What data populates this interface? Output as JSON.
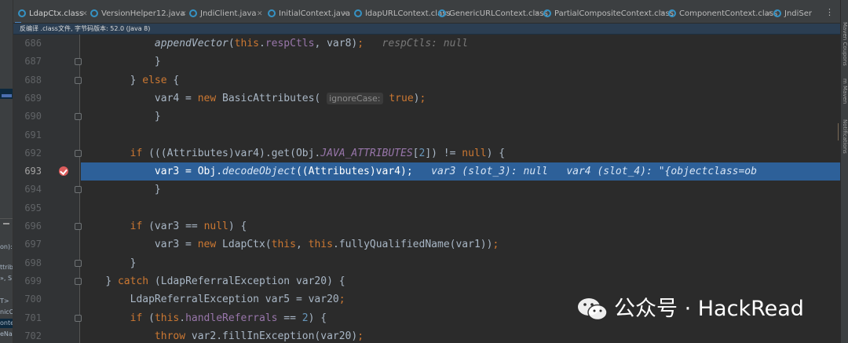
{
  "tabs": [
    {
      "label": "LdapCtx.class",
      "active": true
    },
    {
      "label": "VersionHelper12.java",
      "active": false
    },
    {
      "label": "JndiClient.java",
      "active": false
    },
    {
      "label": "InitialContext.java",
      "active": false
    },
    {
      "label": "ldapURLContext.class",
      "active": false
    },
    {
      "label": "GenericURLContext.class",
      "active": false
    },
    {
      "label": "PartialCompositeContext.class",
      "active": false
    },
    {
      "label": "ComponentContext.class",
      "active": false
    },
    {
      "label": "JndiSer",
      "active": false
    }
  ],
  "tab_overflow_glyph": "⋮",
  "notice": "反编译 .class文件, 字节码版本: 52.0 (Java 8)",
  "left_panel_fragments": [
    "on):",
    "ttrib",
    "», S",
    "T>",
    "nicC",
    "onte",
    "eNa"
  ],
  "right_panel_labels": [
    "Maven Coupons",
    "m Maven",
    "Notifications"
  ],
  "code": {
    "current_line": 693,
    "lines": [
      {
        "num": "686",
        "pre": "            ",
        "parts": [
          {
            "t": "appendVector",
            "c": "it"
          },
          {
            "t": "("
          },
          {
            "t": "this",
            "c": "kw"
          },
          {
            "t": "."
          },
          {
            "t": "respCtls",
            "c": "fld"
          },
          {
            "t": ", var8)"
          },
          {
            "t": ";",
            "c": "kw"
          },
          {
            "t": "   respCtls: null",
            "c": "hint"
          }
        ]
      },
      {
        "num": "687",
        "pre": "            ",
        "parts": [
          {
            "t": "}"
          }
        ]
      },
      {
        "num": "688",
        "pre": "        ",
        "parts": [
          {
            "t": "} "
          },
          {
            "t": "else",
            "c": "kw"
          },
          {
            "t": " {"
          }
        ]
      },
      {
        "num": "689",
        "pre": "            ",
        "parts": [
          {
            "t": "var4 = "
          },
          {
            "t": "new",
            "c": "kw"
          },
          {
            "t": " BasicAttributes( "
          },
          {
            "t": "ignoreCase:",
            "c": "phint"
          },
          {
            "t": " "
          },
          {
            "t": "true",
            "c": "kw"
          },
          {
            "t": ")"
          },
          {
            "t": ";",
            "c": "kw"
          }
        ]
      },
      {
        "num": "690",
        "pre": "            ",
        "parts": [
          {
            "t": "}"
          }
        ]
      },
      {
        "num": "691",
        "pre": "",
        "parts": []
      },
      {
        "num": "692",
        "pre": "        ",
        "parts": [
          {
            "t": "if",
            "c": "kw"
          },
          {
            "t": " (((Attributes)var4).get(Obj."
          },
          {
            "t": "JAVA_ATTRIBUTES",
            "c": "st"
          },
          {
            "t": "["
          },
          {
            "t": "2",
            "c": "num"
          },
          {
            "t": "]) != "
          },
          {
            "t": "null",
            "c": "kw"
          },
          {
            "t": ") {"
          }
        ]
      },
      {
        "num": "693",
        "pre": "            ",
        "parts": [
          {
            "t": "var3 = Obj."
          },
          {
            "t": "decodeObject",
            "c": "it"
          },
          {
            "t": "((Attributes)var4)"
          },
          {
            "t": ";",
            "c": "kw"
          },
          {
            "t": "   var3 (slot_3): null   var4 (slot_4): \"{objectclass=ob",
            "c": "hint"
          }
        ]
      },
      {
        "num": "694",
        "pre": "            ",
        "parts": [
          {
            "t": "}"
          }
        ]
      },
      {
        "num": "695",
        "pre": "",
        "parts": []
      },
      {
        "num": "696",
        "pre": "        ",
        "parts": [
          {
            "t": "if",
            "c": "kw"
          },
          {
            "t": " (var3 == "
          },
          {
            "t": "null",
            "c": "kw"
          },
          {
            "t": ") {"
          }
        ]
      },
      {
        "num": "697",
        "pre": "            ",
        "parts": [
          {
            "t": "var3 = "
          },
          {
            "t": "new",
            "c": "kw"
          },
          {
            "t": " LdapCtx("
          },
          {
            "t": "this",
            "c": "kw"
          },
          {
            "t": ", "
          },
          {
            "t": "this",
            "c": "kw"
          },
          {
            "t": ".fullyQualifiedName(var1))"
          },
          {
            "t": ";",
            "c": "kw"
          }
        ]
      },
      {
        "num": "698",
        "pre": "        ",
        "parts": [
          {
            "t": "}"
          }
        ]
      },
      {
        "num": "699",
        "pre": "    ",
        "parts": [
          {
            "t": "} "
          },
          {
            "t": "catch",
            "c": "kw"
          },
          {
            "t": " (LdapReferralException var20) {"
          }
        ]
      },
      {
        "num": "700",
        "pre": "        ",
        "parts": [
          {
            "t": "LdapReferralException var5 = var20"
          },
          {
            "t": ";",
            "c": "kw"
          }
        ]
      },
      {
        "num": "701",
        "pre": "        ",
        "parts": [
          {
            "t": "if",
            "c": "kw"
          },
          {
            "t": " ("
          },
          {
            "t": "this",
            "c": "kw"
          },
          {
            "t": "."
          },
          {
            "t": "handleReferrals",
            "c": "fld"
          },
          {
            "t": " == "
          },
          {
            "t": "2",
            "c": "num"
          },
          {
            "t": ") {"
          }
        ]
      },
      {
        "num": "702",
        "pre": "            ",
        "parts": [
          {
            "t": "throw",
            "c": "kw"
          },
          {
            "t": " var2.fillInException(var20)"
          },
          {
            "t": ";",
            "c": "kw"
          }
        ]
      }
    ]
  },
  "watermark": "公众号 · HackRead"
}
